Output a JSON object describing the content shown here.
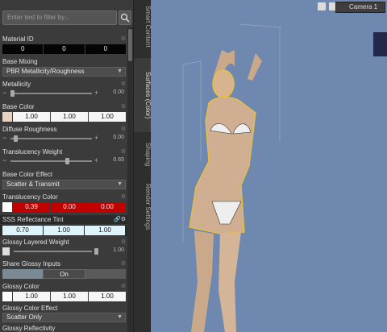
{
  "search": {
    "placeholder": "Enter text to filter by..."
  },
  "tabs": {
    "smart": "Smart Content",
    "surfaces": "Surfaces (Color)",
    "shaping": "Shaping",
    "render": "Render Settings"
  },
  "viewport": {
    "camera": "Camera 1"
  },
  "props": {
    "material_id": {
      "label": "Material ID",
      "v": [
        "0",
        "0",
        "0"
      ]
    },
    "base_mixing": {
      "label": "Base Mixing",
      "value": "PBR Metallicity/Roughness"
    },
    "metallicity": {
      "label": "Metallicity",
      "value": "0.00"
    },
    "base_color": {
      "label": "Base Color",
      "v": [
        "1.00",
        "1.00",
        "1.00"
      ]
    },
    "diffuse_roughness": {
      "label": "Diffuse Roughness",
      "value": "0.00"
    },
    "translucency_weight": {
      "label": "Translucency Weight",
      "value": "0.65"
    },
    "base_color_effect": {
      "label": "Base Color Effect",
      "value": "Scatter & Transmit"
    },
    "translucency_color": {
      "label": "Translucency Color",
      "v": [
        "0.39",
        "0.00",
        "0.00"
      ]
    },
    "sss_tint": {
      "label": "SSS Reflectance Tint",
      "v": [
        "0.70",
        "1.00",
        "1.00"
      ]
    },
    "glossy_layered_weight": {
      "label": "Glossy Layered Weight",
      "value": "1.00"
    },
    "share_glossy": {
      "label": "Share Glossy Inputs",
      "value": "On"
    },
    "glossy_color": {
      "label": "Glossy Color",
      "v": [
        "1.00",
        "1.00",
        "1.00"
      ]
    },
    "glossy_color_effect": {
      "label": "Glossy Color Effect",
      "value": "Scatter Only"
    },
    "glossy_reflectivity": {
      "label": "Glossy Reflectivity"
    }
  }
}
